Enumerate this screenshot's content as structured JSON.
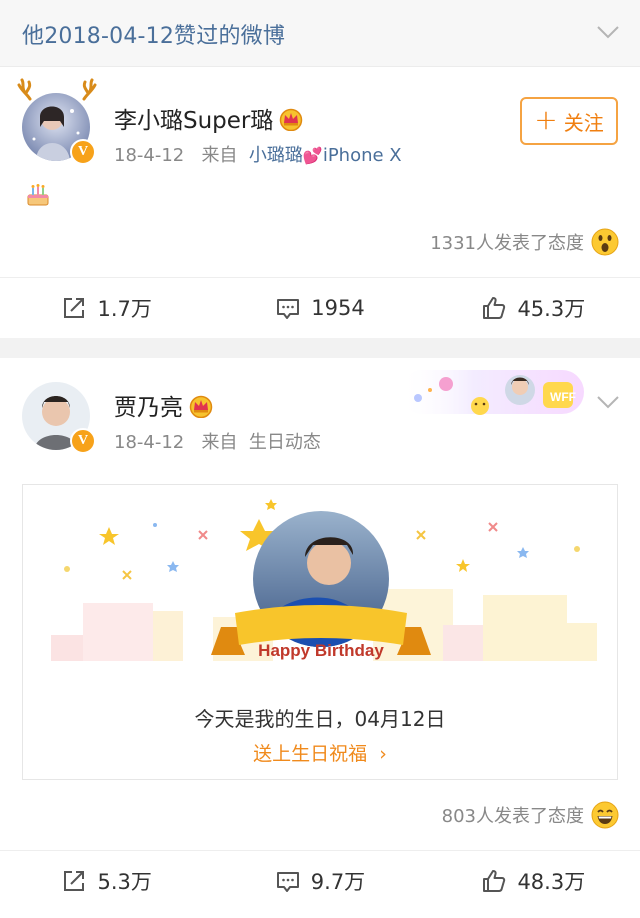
{
  "header": {
    "title": "他2018-04-12赞过的微博"
  },
  "posts": [
    {
      "username": "李小璐Super璐",
      "date": "18-4-12",
      "source_prefix": "来自",
      "source_name": "小璐璐",
      "source_device": "iPhone X",
      "follow_label": "关注",
      "reactions_text": "1331人发表了态度",
      "repost": "1.7万",
      "comments": "1954",
      "likes": "45.3万"
    },
    {
      "username": "贾乃亮",
      "date": "18-4-12",
      "source_prefix": "来自",
      "source_name": "生日动态",
      "birthday_banner": "Happy Birthday",
      "birthday_text": "今天是我的生日，04月12日",
      "birthday_link": "送上生日祝福",
      "reactions_text": "803人发表了态度",
      "repost": "5.3万",
      "comments": "9.7万",
      "likes": "48.3万",
      "promo_badge": "WFF"
    }
  ],
  "colors": {
    "link": "#4a6f9a",
    "accent": "#f07f10",
    "vip": "#f7a21a"
  },
  "icons": [
    "chevron-down-icon",
    "crown-icon",
    "verified-icon",
    "cake-icon",
    "surprised-emoji-icon",
    "grin-emoji-icon",
    "repost-icon",
    "comment-icon",
    "like-icon",
    "chevron-right-icon"
  ]
}
